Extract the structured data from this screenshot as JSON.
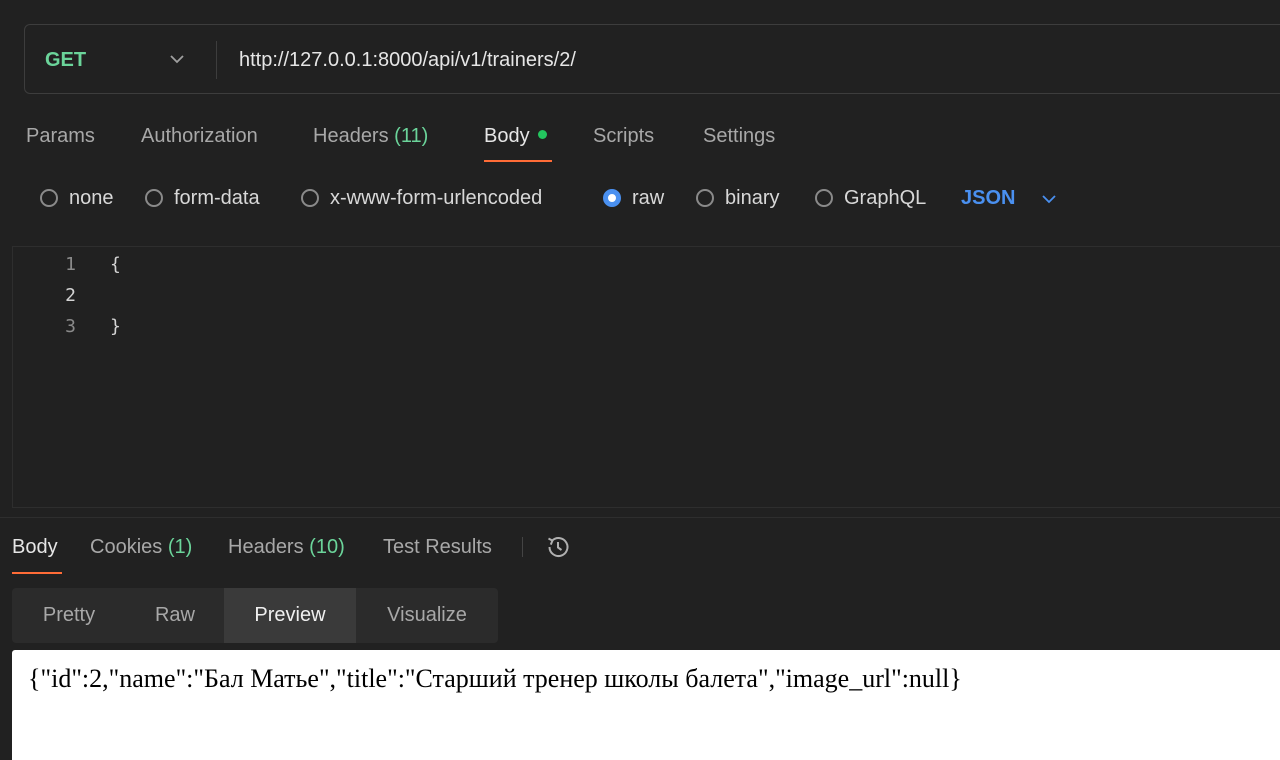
{
  "request": {
    "method": "GET",
    "url": "http://127.0.0.1:8000/api/v1/trainers/2/"
  },
  "request_tabs": [
    {
      "label": "Params"
    },
    {
      "label": "Authorization"
    },
    {
      "label": "Headers",
      "count": "(11)"
    },
    {
      "label": "Body",
      "active": true
    },
    {
      "label": "Scripts"
    },
    {
      "label": "Settings"
    }
  ],
  "body_types": [
    {
      "label": "none",
      "selected": false
    },
    {
      "label": "form-data",
      "selected": false
    },
    {
      "label": "x-www-form-urlencoded",
      "selected": false
    },
    {
      "label": "raw",
      "selected": true
    },
    {
      "label": "binary",
      "selected": false
    },
    {
      "label": "GraphQL",
      "selected": false
    }
  ],
  "raw_format": "JSON",
  "editor": {
    "lines": [
      {
        "number": "1",
        "text": "{"
      },
      {
        "number": "2",
        "text": ""
      },
      {
        "number": "3",
        "text": "}"
      }
    ]
  },
  "response_tabs": [
    {
      "label": "Body",
      "active": true
    },
    {
      "label": "Cookies",
      "count": "(1)"
    },
    {
      "label": "Headers",
      "count": "(10)"
    },
    {
      "label": "Test Results"
    }
  ],
  "view_modes": [
    {
      "label": "Pretty"
    },
    {
      "label": "Raw"
    },
    {
      "label": "Preview",
      "active": true
    },
    {
      "label": "Visualize"
    }
  ],
  "preview_content": "{\"id\":2,\"name\":\"Бал Матье\",\"title\":\"Старший тренер школы балета\",\"image_url\":null}",
  "colors": {
    "accent_underline": "#ff6c37",
    "method_green": "#6bd49a",
    "link_blue": "#4a90f0",
    "status_dot": "#23c55e"
  },
  "icons": [
    "chevron-down-icon",
    "history-icon"
  ]
}
